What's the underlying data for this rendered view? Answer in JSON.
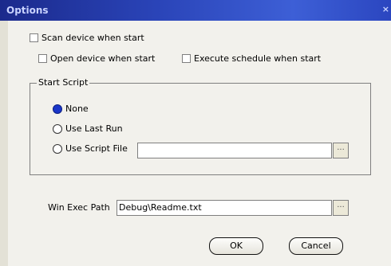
{
  "window": {
    "title": "Options",
    "close_label": "×"
  },
  "checkboxes": {
    "scan": {
      "label": "Scan device when start",
      "checked": false
    },
    "open": {
      "label": "Open device when start",
      "checked": false
    },
    "execute": {
      "label": "Execute schedule when start",
      "checked": false
    }
  },
  "start_script": {
    "legend": "Start Script",
    "selected": "none",
    "options": {
      "none": "None",
      "last_run": "Use Last Run",
      "script_file": "Use Script File"
    },
    "script_file_value": "",
    "browse_label": "..."
  },
  "win_exec": {
    "label": "Win Exec Path",
    "value": "Debug\\Readme.txt",
    "browse_label": "..."
  },
  "buttons": {
    "ok": "OK",
    "cancel": "Cancel"
  }
}
